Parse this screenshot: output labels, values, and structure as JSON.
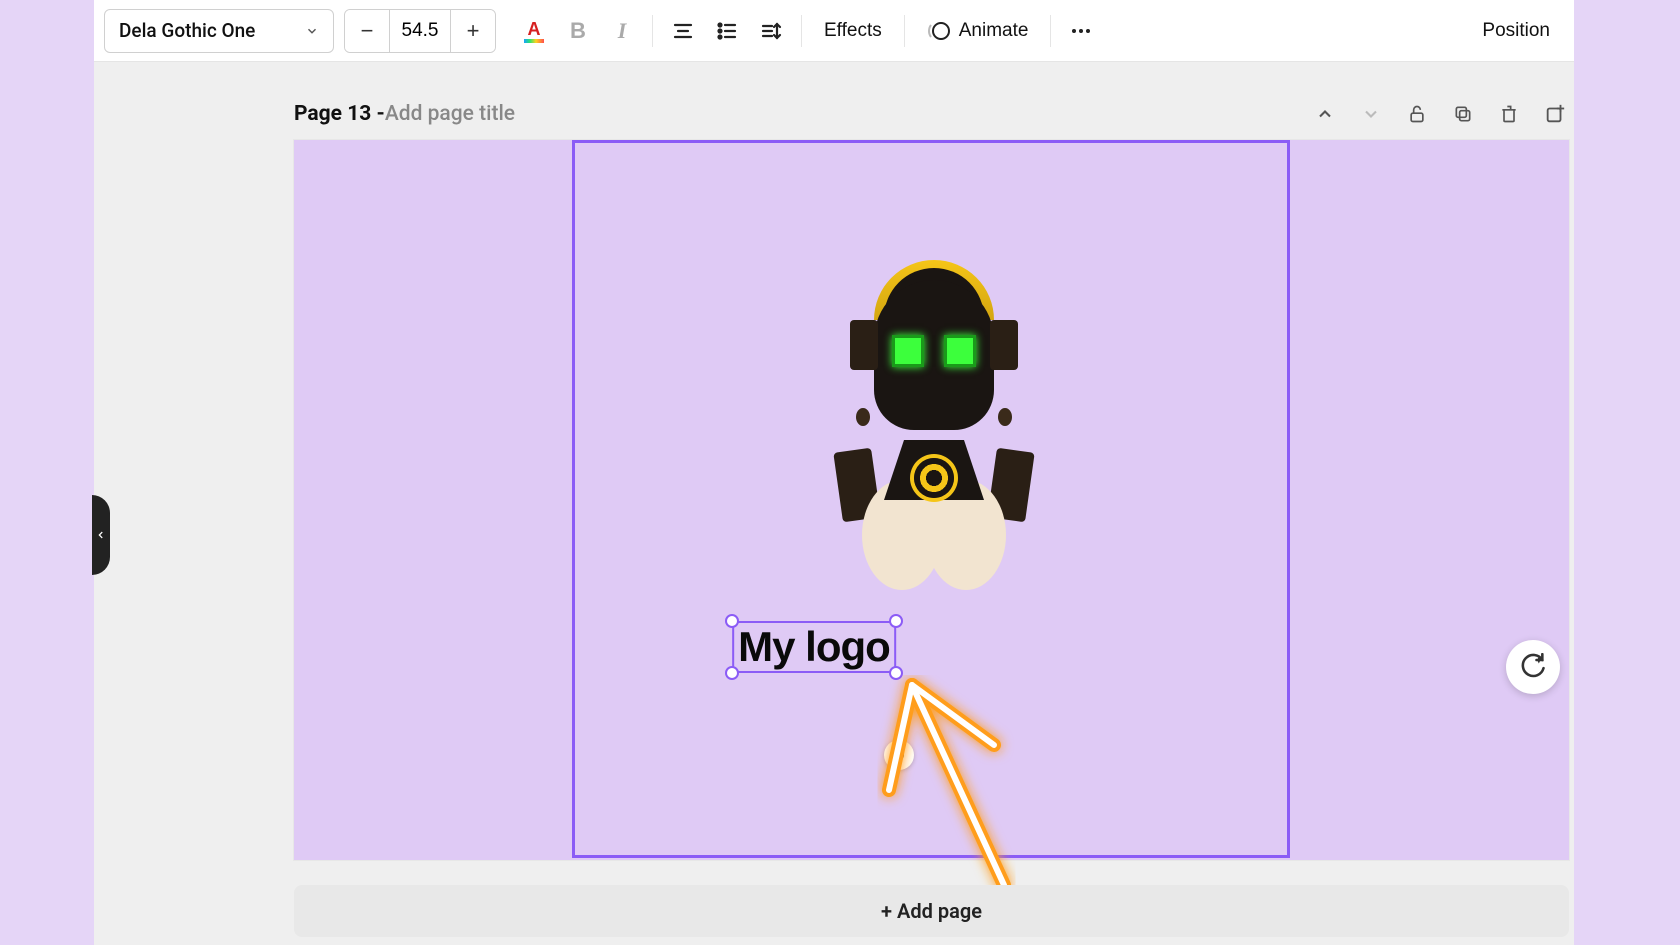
{
  "toolbar": {
    "font_name": "Dela Gothic One",
    "font_size": "54.5",
    "effects_label": "Effects",
    "animate_label": "Animate",
    "position_label": "Position"
  },
  "page": {
    "label": "Page 13 - ",
    "title_placeholder": "Add page title"
  },
  "canvas": {
    "text_value": "My logo"
  },
  "add_page_label": "+ Add page"
}
